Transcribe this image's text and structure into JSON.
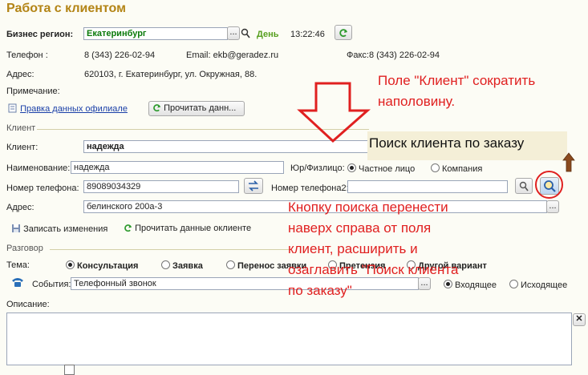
{
  "window": {
    "title": "Работа с клиентом"
  },
  "header": {
    "region_label": "Бизнес регион:",
    "region_value": "Екатеринбург",
    "day_label": "День",
    "time": "13:22:46",
    "phone_label": "Телефон :",
    "phone_value": "8 (343) 226-02-94",
    "email_label": "Email: ekb@geradez.ru",
    "fax_label": "Факс:8 (343) 226-02-94",
    "address_label": "Адрес:",
    "address_value": "620103, г. Екатеринбург, ул. Окружная, 88.",
    "note_label": "Примечание:",
    "edit_link": "Правка данных офилиале",
    "read_button": "Прочитать данн..."
  },
  "client": {
    "section_label": "Клиент",
    "client_label": "Клиент:",
    "client_value": "надежда",
    "name_label": "Наименование:",
    "name_value": "надежда",
    "type_label": "Юр/Физлицо:",
    "type_options": [
      "Частное лицо",
      "Компания"
    ],
    "phone_label": "Номер телефона:",
    "phone_value": "89089034329",
    "phone2_label": "Номер телефона2:",
    "address_label": "Адрес:",
    "address_value": "белинского 200а-3",
    "save_button": "Записать изменения",
    "read_button": "Прочитать данные оклиенте"
  },
  "conversation": {
    "section_label": "Разговор",
    "topic_label": "Тема:",
    "topics": [
      "Консультация",
      "Заявка",
      "Перенос заявки",
      "Претензия",
      "Другой вариант"
    ],
    "events_label": "События:",
    "events_value": "Телефонный звонок",
    "direction_options": [
      "Входящее",
      "Исходящее"
    ],
    "description_label": "Описание:"
  },
  "annotations": {
    "note1_lines": [
      "Поле \"Клиент\" сократить",
      "наполовину."
    ],
    "callout": "Поиск клиента по заказу",
    "note2_lines": [
      "Кнопку поиска перенести",
      "наверх справа от поля",
      "клиент, расширить и",
      "озаглавить \"Поиск клиента",
      "по заказу\""
    ]
  },
  "colors": {
    "title": "#b38415",
    "annotation": "#e02020",
    "callout_bg": "#f4efd7",
    "arrow": "#e02020",
    "up_arrow": "#8b4a1e"
  },
  "icons": [
    "ellipsis-icon",
    "search-icon",
    "refresh-icon",
    "swap-icon",
    "save-icon",
    "phone-icon",
    "close-icon",
    "down-arrow-icon",
    "up-arrow-icon",
    "magnifier-icon"
  ]
}
